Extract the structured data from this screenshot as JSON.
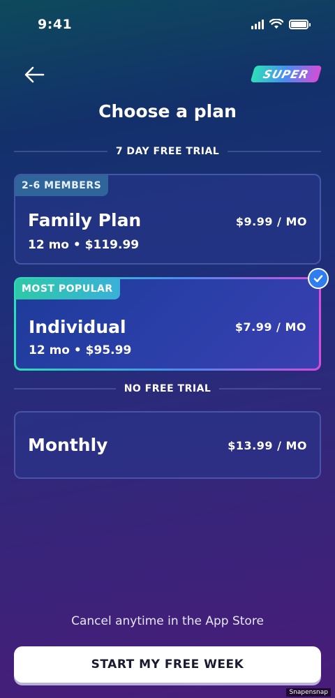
{
  "status_bar": {
    "time": "9:41"
  },
  "header": {
    "badge_label": "SUPER",
    "title": "Choose a plan"
  },
  "sections": {
    "trial_label": "7 DAY FREE TRIAL",
    "no_trial_label": "NO FREE TRIAL"
  },
  "plans": [
    {
      "tag": "2-6 MEMBERS",
      "name": "Family Plan",
      "sub": "12 mo • $119.99",
      "price": "$9.99 / MO",
      "selected": false
    },
    {
      "tag": "MOST POPULAR",
      "name": "Individual",
      "sub": "12 mo • $95.99",
      "price": "$7.99 / MO",
      "selected": true
    },
    {
      "tag": "",
      "name": "Monthly",
      "sub": "",
      "price": "$13.99 / MO",
      "selected": false
    }
  ],
  "footer": {
    "cancel_note": "Cancel anytime in the App Store",
    "cta_label": "START MY FREE WEEK"
  },
  "watermark": "Snapensnap",
  "colors": {
    "accent_green": "#2de0b8",
    "accent_blue": "#2f7df0",
    "accent_pink": "#d64dd8"
  }
}
